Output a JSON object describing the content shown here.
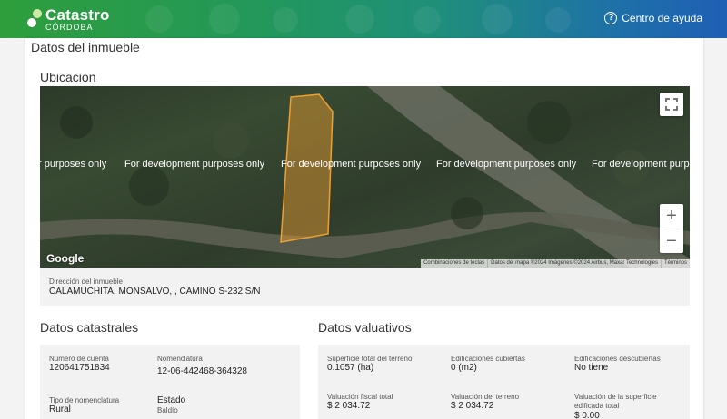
{
  "header": {
    "logo_title": "Catastro",
    "logo_subtitle": "CÓRDOBA",
    "help_label": "Centro de ayuda",
    "brand_colors": {
      "green": "#2e9e3c",
      "blue": "#1f5fb5"
    }
  },
  "page": {
    "section_title": "Datos del inmueble",
    "location_title": "Ubicación"
  },
  "map": {
    "watermark_text": "For development purposes only",
    "watermark_visible": [
      "r purposes only",
      "For development purposes only",
      "For development purposes only",
      "For development purposes only",
      "For development purposes only"
    ],
    "brand": "Google",
    "attribution": [
      "Combinaciones de teclas",
      "Datos del mapa ©2024 Imágenes ©2024 Airbus, Maxar Technologies",
      "Términos"
    ],
    "fullscreen_icon": "fullscreen-icon",
    "zoom_in": "+",
    "zoom_out": "−",
    "parcel_color": "#f0a030"
  },
  "address": {
    "label": "Dirección del inmueble",
    "value": "CALAMUCHITA, MONSALVO, , CAMINO S-232 S/N"
  },
  "cadastral": {
    "title": "Datos catastrales",
    "account_label": "Número de cuenta",
    "account_value": "120641751834",
    "nomenclature_label": "Nomenclatura",
    "nomenclature_value": "12-06-442468-364328",
    "type_label": "Tipo de nomenclatura",
    "type_value": "Rural",
    "state_label": "Estado",
    "state_value": "Baldío"
  },
  "valuation": {
    "title": "Datos valuativos",
    "area_label": "Superficie total del terreno",
    "area_value": "0.1057 (ha)",
    "covered_label": "Edificaciones cubiertas",
    "covered_value": "0 (m2)",
    "uncovered_label": "Edificaciones descubiertas",
    "uncovered_value": "No tiene",
    "fiscal_label": "Valuación fiscal total",
    "fiscal_value": "$ 2 034.72",
    "land_label": "Valuación del terreno",
    "land_value": "$ 2 034.72",
    "built_label_line1": "Valuación de la superficie",
    "built_label_line2": "edificada total",
    "built_value": "$ 0.00"
  }
}
